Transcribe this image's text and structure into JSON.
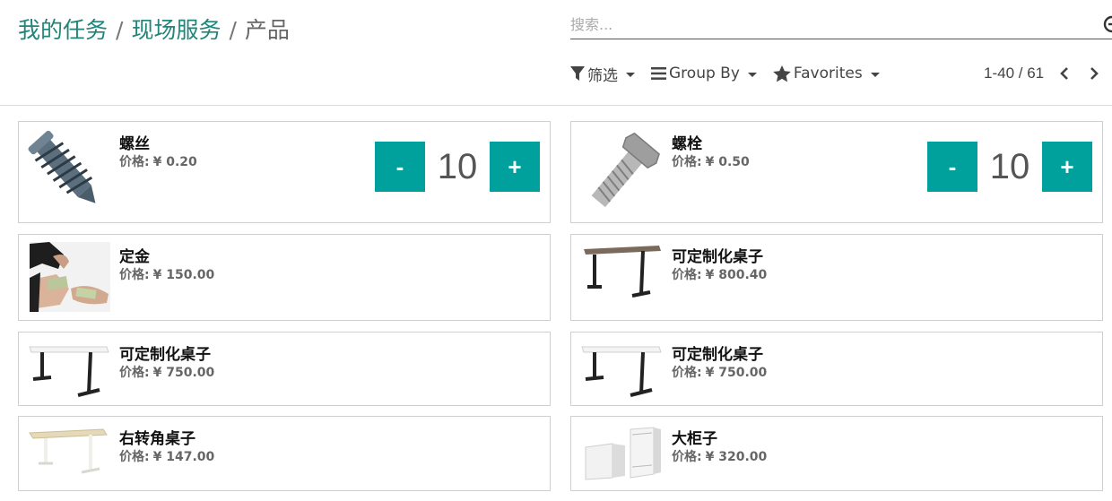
{
  "breadcrumb": {
    "items": [
      "我的任务",
      "现场服务"
    ],
    "separator": "/",
    "current": "产品"
  },
  "search": {
    "placeholder": "搜索..."
  },
  "options": {
    "filter_label": "筛选",
    "groupby_label": "Group By",
    "favorites_label": "Favorites"
  },
  "pager": {
    "value": "1-40 / 61"
  },
  "colors": {
    "accent": "#00a09d",
    "link": "#21857a"
  },
  "products": [
    {
      "name": "螺丝",
      "price_label": "价格:",
      "price": "¥ 0.20",
      "qty": "10",
      "icon": "screw-image"
    },
    {
      "name": "螺栓",
      "price_label": "价格:",
      "price": "¥ 0.50",
      "qty": "10",
      "icon": "bolt-image"
    },
    {
      "name": "定金",
      "price_label": "价格:",
      "price": "¥ 150.00",
      "icon": "money-image"
    },
    {
      "name": "可定制化桌子",
      "price_label": "价格:",
      "price": "¥ 800.40",
      "icon": "desk-image"
    },
    {
      "name": "可定制化桌子",
      "price_label": "价格:",
      "price": "¥ 750.00",
      "icon": "desk-image"
    },
    {
      "name": "可定制化桌子",
      "price_label": "价格:",
      "price": "¥ 750.00",
      "icon": "desk-image"
    },
    {
      "name": "右转角桌子",
      "price_label": "价格:",
      "price": "¥ 147.00",
      "icon": "corner-desk-image"
    },
    {
      "name": "大柜子",
      "price_label": "价格:",
      "price": "¥ 320.00",
      "icon": "cabinet-image"
    }
  ],
  "qty_controls": {
    "minus": "-",
    "plus": "+"
  }
}
